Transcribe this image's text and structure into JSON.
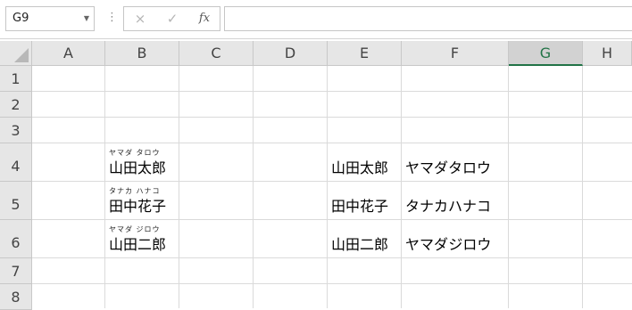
{
  "name_box": {
    "value": "G9"
  },
  "formula_bar": {
    "cancel_icon": "×",
    "enter_icon": "✓",
    "insert_function_label": "fx",
    "content": ""
  },
  "columns": [
    "A",
    "B",
    "C",
    "D",
    "E",
    "F",
    "G",
    "H"
  ],
  "rows": [
    "1",
    "2",
    "3",
    "4",
    "5",
    "6",
    "7",
    "8"
  ],
  "selected_column": "G",
  "cells": {
    "B4": {
      "furigana": "ヤマダ タロウ",
      "value": "山田太郎"
    },
    "B5": {
      "furigana": "タナカ ハナコ",
      "value": "田中花子"
    },
    "B6": {
      "furigana": "ヤマダ ジロウ",
      "value": "山田二郎"
    },
    "E4": {
      "value": "山田太郎"
    },
    "E5": {
      "value": "田中花子"
    },
    "E6": {
      "value": "山田二郎"
    },
    "F4": {
      "value": "ヤマダタロウ"
    },
    "F5": {
      "value": "タナカハナコ"
    },
    "F6": {
      "value": "ヤマダジロウ"
    }
  },
  "colors": {
    "accent": "#217346",
    "header_bg": "#e6e6e6",
    "gridline": "#dadada"
  }
}
